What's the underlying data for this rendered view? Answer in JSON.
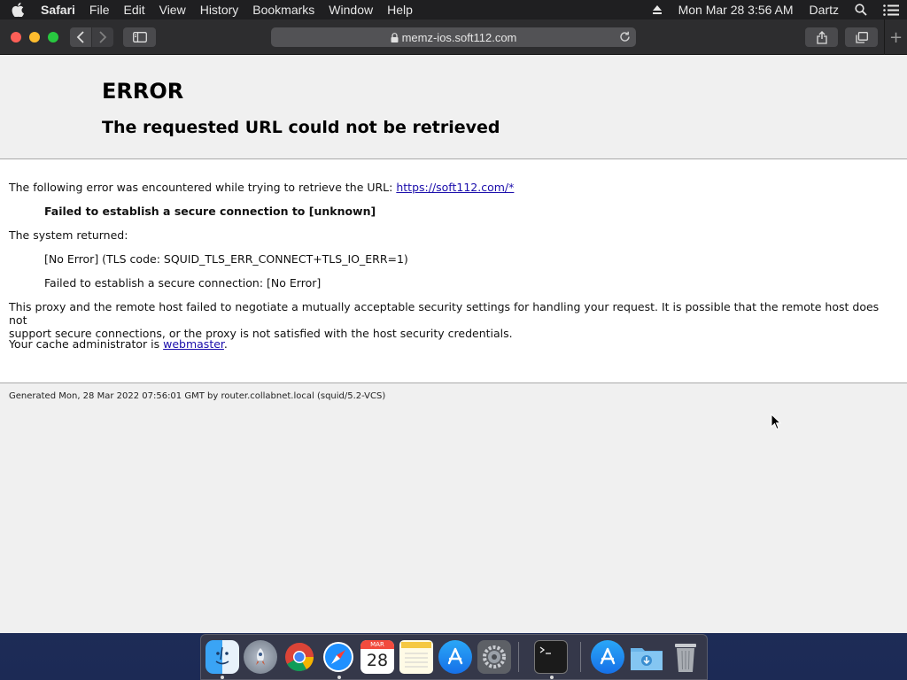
{
  "menubar": {
    "app_name": "Safari",
    "items": [
      "File",
      "Edit",
      "View",
      "History",
      "Bookmarks",
      "Window",
      "Help"
    ],
    "clock": "Mon Mar 28  3:56 AM",
    "user": "Dartz"
  },
  "browser": {
    "url": "memz-ios.soft112.com"
  },
  "page": {
    "title": "ERROR",
    "subtitle": "The requested URL could not be retrieved",
    "intro_text": "The following error was encountered while trying to retrieve the URL: ",
    "intro_link": "https://soft112.com/*",
    "error_title": "Failed to establish a secure connection to [unknown]",
    "system_returned": "The system returned:",
    "tls_code": "[No Error] (TLS code: SQUID_TLS_ERR_CONNECT+TLS_IO_ERR=1)",
    "tls_message": "Failed to establish a secure connection: [No Error]",
    "explanation_line1": "This proxy and the remote host failed to negotiate a mutually acceptable security settings for handling your request. It is possible that the remote host does not",
    "explanation_line2": "support secure connections, or the proxy is not satisfied with the host security credentials.",
    "admin_text": "Your cache administrator is ",
    "admin_link": "webmaster",
    "admin_suffix": ".",
    "footer": "Generated Mon, 28 Mar 2022 07:56:01 GMT by router.collabnet.local (squid/5.2-VCS)"
  },
  "dock": {
    "calendar_month": "MAR",
    "calendar_day": "28",
    "apps": [
      "finder-icon",
      "launchpad-icon",
      "chrome-icon",
      "safari-icon",
      "calendar-icon",
      "notes-icon",
      "app-store-icon",
      "system-preferences-icon",
      "terminal-icon",
      "app-store-folder-icon",
      "downloads-folder-icon",
      "trash-icon"
    ]
  },
  "colors": {
    "link": "#1a0dab",
    "menubar": "#1f1f21",
    "toolbar": "#2d2d2f"
  }
}
